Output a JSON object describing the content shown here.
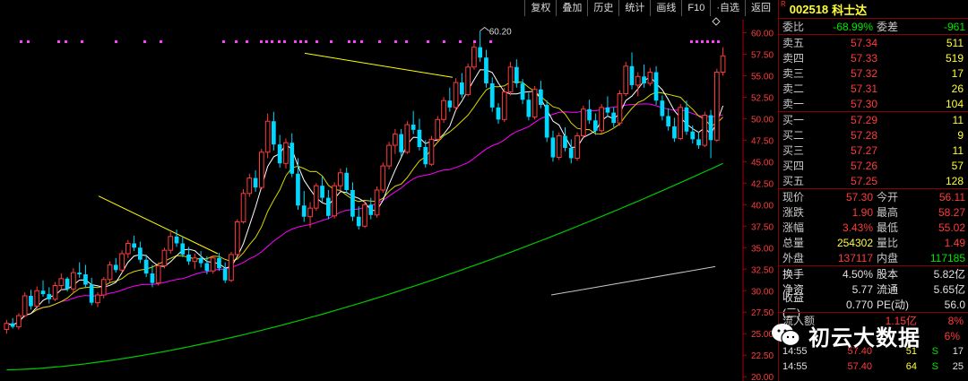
{
  "toolbar": [
    "复权",
    "叠加",
    "历史",
    "统计",
    "画线",
    "F10",
    "·自选",
    "返回"
  ],
  "chart_data": {
    "type": "candlestick",
    "y_ticks": [
      "60.00",
      "57.50",
      "55.00",
      "52.50",
      "50.00",
      "47.50",
      "45.00",
      "42.50",
      "40.00",
      "37.50",
      "35.00",
      "32.50",
      "30.00",
      "27.50",
      "25.00",
      "22.50",
      "20.00"
    ],
    "ylim": [
      19.5,
      61.5
    ],
    "peak_label": "60.20",
    "candles": [
      [
        25.5,
        26.6,
        25.0,
        26.2
      ],
      [
        26.2,
        26.8,
        25.6,
        25.8
      ],
      [
        25.8,
        27.4,
        25.5,
        27.1
      ],
      [
        27.1,
        29.8,
        26.9,
        29.4
      ],
      [
        29.4,
        30.1,
        27.8,
        28.2
      ],
      [
        28.2,
        30.5,
        27.9,
        30.0
      ],
      [
        30.0,
        31.2,
        29.3,
        29.6
      ],
      [
        29.6,
        30.4,
        28.5,
        29.0
      ],
      [
        29.0,
        31.0,
        28.8,
        30.6
      ],
      [
        30.6,
        32.0,
        30.1,
        31.4
      ],
      [
        31.4,
        31.6,
        29.9,
        30.2
      ],
      [
        30.2,
        32.6,
        29.8,
        32.1
      ],
      [
        32.1,
        33.3,
        31.5,
        31.9
      ],
      [
        31.9,
        33.0,
        30.4,
        30.7
      ],
      [
        30.7,
        31.5,
        28.3,
        28.6
      ],
      [
        28.6,
        29.8,
        28.1,
        29.5
      ],
      [
        29.5,
        31.6,
        29.1,
        31.3
      ],
      [
        31.3,
        33.4,
        31.0,
        33.0
      ],
      [
        33.0,
        33.8,
        32.1,
        32.4
      ],
      [
        32.4,
        34.7,
        32.1,
        34.3
      ],
      [
        34.3,
        35.9,
        33.8,
        35.5
      ],
      [
        35.5,
        36.4,
        34.6,
        35.0
      ],
      [
        35.0,
        35.7,
        33.2,
        33.6
      ],
      [
        33.6,
        34.2,
        31.6,
        32.0
      ],
      [
        32.0,
        33.0,
        30.4,
        30.9
      ],
      [
        30.9,
        33.3,
        30.6,
        32.9
      ],
      [
        32.9,
        35.0,
        32.6,
        34.7
      ],
      [
        34.7,
        36.8,
        34.3,
        36.3
      ],
      [
        36.3,
        37.1,
        35.1,
        35.5
      ],
      [
        35.5,
        36.3,
        33.9,
        34.2
      ],
      [
        34.2,
        35.1,
        33.0,
        33.4
      ],
      [
        33.4,
        34.3,
        32.5,
        33.8
      ],
      [
        33.8,
        34.6,
        32.7,
        33.2
      ],
      [
        33.2,
        34.0,
        31.9,
        32.3
      ],
      [
        32.3,
        34.1,
        32.0,
        33.8
      ],
      [
        33.8,
        34.4,
        32.3,
        32.6
      ],
      [
        32.6,
        33.3,
        30.9,
        31.2
      ],
      [
        31.2,
        34.5,
        31.0,
        34.2
      ],
      [
        34.2,
        38.3,
        34.0,
        38.0
      ],
      [
        38.0,
        41.8,
        37.8,
        41.3
      ],
      [
        41.3,
        43.6,
        40.9,
        43.1
      ],
      [
        43.1,
        44.0,
        41.5,
        42.0
      ],
      [
        42.0,
        46.5,
        41.8,
        46.1
      ],
      [
        46.1,
        50.6,
        45.4,
        49.7
      ],
      [
        49.7,
        50.8,
        46.3,
        47.0
      ],
      [
        47.0,
        48.1,
        44.3,
        44.8
      ],
      [
        44.8,
        47.7,
        44.2,
        47.2
      ],
      [
        47.2,
        48.3,
        43.2,
        43.6
      ],
      [
        43.6,
        45.4,
        39.4,
        39.9
      ],
      [
        39.9,
        41.6,
        38.0,
        38.6
      ],
      [
        38.6,
        40.3,
        37.3,
        39.6
      ],
      [
        39.6,
        42.5,
        39.3,
        42.2
      ],
      [
        42.2,
        43.3,
        40.3,
        40.8
      ],
      [
        40.8,
        41.7,
        38.3,
        38.7
      ],
      [
        38.7,
        42.6,
        38.4,
        42.2
      ],
      [
        42.2,
        44.2,
        41.6,
        43.7
      ],
      [
        43.7,
        44.3,
        41.3,
        41.7
      ],
      [
        41.7,
        42.6,
        38.1,
        38.6
      ],
      [
        38.6,
        39.8,
        37.1,
        37.5
      ],
      [
        37.5,
        40.4,
        37.3,
        40.0
      ],
      [
        40.0,
        40.8,
        38.3,
        38.8
      ],
      [
        38.8,
        42.1,
        38.5,
        41.7
      ],
      [
        41.7,
        44.9,
        41.4,
        44.5
      ],
      [
        44.5,
        47.3,
        44.1,
        46.9
      ],
      [
        46.9,
        48.8,
        45.9,
        48.2
      ],
      [
        48.2,
        48.8,
        45.6,
        46.1
      ],
      [
        46.1,
        49.7,
        45.9,
        49.3
      ],
      [
        49.3,
        50.9,
        48.2,
        48.7
      ],
      [
        48.7,
        50.0,
        46.3,
        46.7
      ],
      [
        46.7,
        47.5,
        44.3,
        44.7
      ],
      [
        44.7,
        48.0,
        44.5,
        47.6
      ],
      [
        47.6,
        50.3,
        47.3,
        49.9
      ],
      [
        49.9,
        52.5,
        49.5,
        52.1
      ],
      [
        52.1,
        53.6,
        50.8,
        51.3
      ],
      [
        51.3,
        54.7,
        51.0,
        54.2
      ],
      [
        54.2,
        55.3,
        52.4,
        52.8
      ],
      [
        52.8,
        56.4,
        52.6,
        56.0
      ],
      [
        56.0,
        58.8,
        55.7,
        58.3
      ],
      [
        58.3,
        60.2,
        56.6,
        57.1
      ],
      [
        57.1,
        58.0,
        53.6,
        54.1
      ],
      [
        54.1,
        54.8,
        50.8,
        51.3
      ],
      [
        51.3,
        51.8,
        49.4,
        49.9
      ],
      [
        49.9,
        53.6,
        49.6,
        53.1
      ],
      [
        53.1,
        56.6,
        52.7,
        56.0
      ],
      [
        56.0,
        56.9,
        53.6,
        54.1
      ],
      [
        54.1,
        54.6,
        51.7,
        52.2
      ],
      [
        52.2,
        53.0,
        49.8,
        50.2
      ],
      [
        50.2,
        53.8,
        49.9,
        53.4
      ],
      [
        53.4,
        54.4,
        51.2,
        51.6
      ],
      [
        51.6,
        52.1,
        47.3,
        47.8
      ],
      [
        47.8,
        48.6,
        45.0,
        45.5
      ],
      [
        45.5,
        48.4,
        45.2,
        48.0
      ],
      [
        48.0,
        49.0,
        46.2,
        46.6
      ],
      [
        46.6,
        47.6,
        44.8,
        45.4
      ],
      [
        45.4,
        48.4,
        45.1,
        48.0
      ],
      [
        48.0,
        51.5,
        47.8,
        51.1
      ],
      [
        51.1,
        52.2,
        49.4,
        49.8
      ],
      [
        49.8,
        50.6,
        48.1,
        48.6
      ],
      [
        48.6,
        51.7,
        48.3,
        51.3
      ],
      [
        51.3,
        52.6,
        50.2,
        50.7
      ],
      [
        50.7,
        51.3,
        49.0,
        49.5
      ],
      [
        49.5,
        53.3,
        49.2,
        52.9
      ],
      [
        52.9,
        56.6,
        52.6,
        56.1
      ],
      [
        56.1,
        57.7,
        53.4,
        53.9
      ],
      [
        53.9,
        55.4,
        52.6,
        54.9
      ],
      [
        54.9,
        56.3,
        53.6,
        54.1
      ],
      [
        54.1,
        55.9,
        53.8,
        55.4
      ],
      [
        55.4,
        56.1,
        51.6,
        52.1
      ],
      [
        52.1,
        52.7,
        49.8,
        50.3
      ],
      [
        50.3,
        51.2,
        48.6,
        49.1
      ],
      [
        49.1,
        50.1,
        47.3,
        47.7
      ],
      [
        47.7,
        51.7,
        47.5,
        51.3
      ],
      [
        51.3,
        52.1,
        48.1,
        48.5
      ],
      [
        48.5,
        49.2,
        47.1,
        47.6
      ],
      [
        47.6,
        48.5,
        46.5,
        46.9
      ],
      [
        46.9,
        50.8,
        46.7,
        50.4
      ],
      [
        50.4,
        51.0,
        45.4,
        47.5
      ],
      [
        47.5,
        55.8,
        47.3,
        55.4
      ],
      [
        55.4,
        58.3,
        55.0,
        57.3
      ]
    ],
    "dash_line_values": [
      22.4,
      29.5
    ]
  },
  "quote": {
    "r_tag": "R",
    "code": "002518",
    "name": "科士达",
    "weibi_label": "委比",
    "weibi_value": "-68.99%",
    "weicha_label": "委差",
    "weicha_value": "-961",
    "asks": [
      {
        "label": "卖五",
        "price": "57.34",
        "vol": "511"
      },
      {
        "label": "卖四",
        "price": "57.33",
        "vol": "519"
      },
      {
        "label": "卖三",
        "price": "57.32",
        "vol": "17"
      },
      {
        "label": "卖二",
        "price": "57.31",
        "vol": "26"
      },
      {
        "label": "卖一",
        "price": "57.30",
        "vol": "104"
      }
    ],
    "bids": [
      {
        "label": "买一",
        "price": "57.29",
        "vol": "11"
      },
      {
        "label": "买二",
        "price": "57.28",
        "vol": "9"
      },
      {
        "label": "买三",
        "price": "57.27",
        "vol": "11"
      },
      {
        "label": "买四",
        "price": "57.26",
        "vol": "57"
      },
      {
        "label": "买五",
        "price": "57.25",
        "vol": "128"
      }
    ],
    "stats": [
      {
        "l1": "现价",
        "v1": "57.30",
        "c1": "red",
        "l2": "今开",
        "v2": "56.11",
        "c2": "red"
      },
      {
        "l1": "涨跌",
        "v1": "1.90",
        "c1": "red",
        "l2": "最高",
        "v2": "58.27",
        "c2": "red"
      },
      {
        "l1": "涨幅",
        "v1": "3.43%",
        "c1": "red",
        "l2": "最低",
        "v2": "55.02",
        "c2": "red"
      },
      {
        "l1": "总量",
        "v1": "254302",
        "c1": "yellow",
        "l2": "量比",
        "v2": "1.49",
        "c2": "red"
      },
      {
        "l1": "外盘",
        "v1": "137117",
        "c1": "red",
        "l2": "内盘",
        "v2": "117185",
        "c2": "green"
      }
    ],
    "stats2": [
      {
        "l1": "换手",
        "v1": "4.50%",
        "l2": "股本",
        "v2": "5.82亿"
      },
      {
        "l1": "净资",
        "v1": "5.77",
        "l2": "流通",
        "v2": "5.65亿"
      },
      {
        "l1": "收益(三)",
        "v1": "0.770",
        "l2": "PE(动)",
        "v2": "56.0"
      }
    ],
    "flow": {
      "label": "流入额",
      "value": "1.15亿",
      "pct1": "8%",
      "pct2": "6%"
    },
    "ticks": [
      {
        "time": "14:55",
        "price": "57.40",
        "vol": "51",
        "side": "S",
        "n": "17"
      },
      {
        "time": "14:55",
        "price": "57.40",
        "vol": "64",
        "side": "S",
        "n": "25"
      }
    ]
  },
  "watermark": {
    "text": "初云大数据"
  }
}
